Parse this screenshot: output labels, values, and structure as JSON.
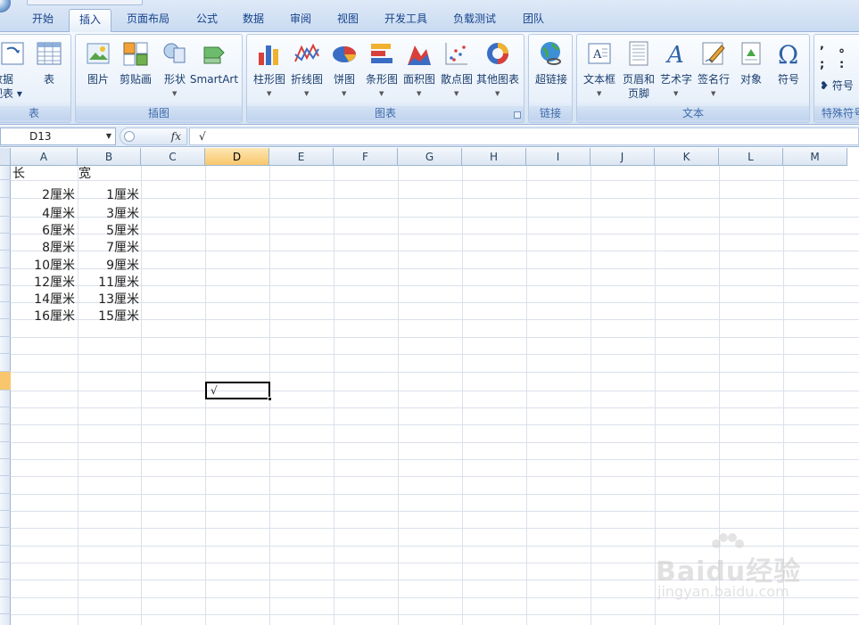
{
  "ribbon_tabs": [
    "开始",
    "插入",
    "页面布局",
    "公式",
    "数据",
    "审阅",
    "视图",
    "开发工具",
    "负载测试",
    "团队"
  ],
  "active_tab": "插入",
  "groups": {
    "table": {
      "label": "表",
      "buttons": [
        "数据\n视表",
        "表"
      ]
    },
    "illustrations": {
      "label": "插图",
      "buttons": [
        "图片",
        "剪贴画",
        "形状",
        "SmartArt"
      ]
    },
    "charts": {
      "label": "图表",
      "buttons": [
        "柱形图",
        "折线图",
        "饼图",
        "条形图",
        "面积图",
        "散点图",
        "其他图表"
      ]
    },
    "links": {
      "label": "链接",
      "buttons": [
        "超链接"
      ]
    },
    "text": {
      "label": "文本",
      "buttons": [
        "文本框",
        "页眉和\n页脚",
        "艺术字",
        "签名行",
        "对象",
        "符号"
      ]
    },
    "special": {
      "label": "特殊符号",
      "buttons": [
        "符号"
      ],
      "symbols": [
        ",",
        "。",
        ";",
        ":"
      ]
    }
  },
  "formula_bar": {
    "name_box": "D13",
    "fx_label": "fx",
    "content": "√"
  },
  "columns": [
    "A",
    "B",
    "C",
    "D",
    "E",
    "F",
    "G",
    "H",
    "I",
    "J",
    "K",
    "L",
    "M"
  ],
  "selected_column": "D",
  "cells": {
    "header": {
      "A": "长",
      "B": "宽"
    },
    "rows": [
      [
        "2厘米",
        "1厘米"
      ],
      [
        "4厘米",
        "3厘米"
      ],
      [
        "6厘米",
        "5厘米"
      ],
      [
        "8厘米",
        "7厘米"
      ],
      [
        "10厘米",
        "9厘米"
      ],
      [
        "12厘米",
        "11厘米"
      ],
      [
        "14厘米",
        "13厘米"
      ],
      [
        "16厘米",
        "15厘米"
      ]
    ],
    "active_value": "√"
  },
  "watermark": {
    "brand": "Baidu经验",
    "url": "jingyan.baidu.com"
  },
  "colors": {
    "accent": "#15428b",
    "selected_header": "#f8c66c",
    "ribbon": "#dfe9f7"
  }
}
